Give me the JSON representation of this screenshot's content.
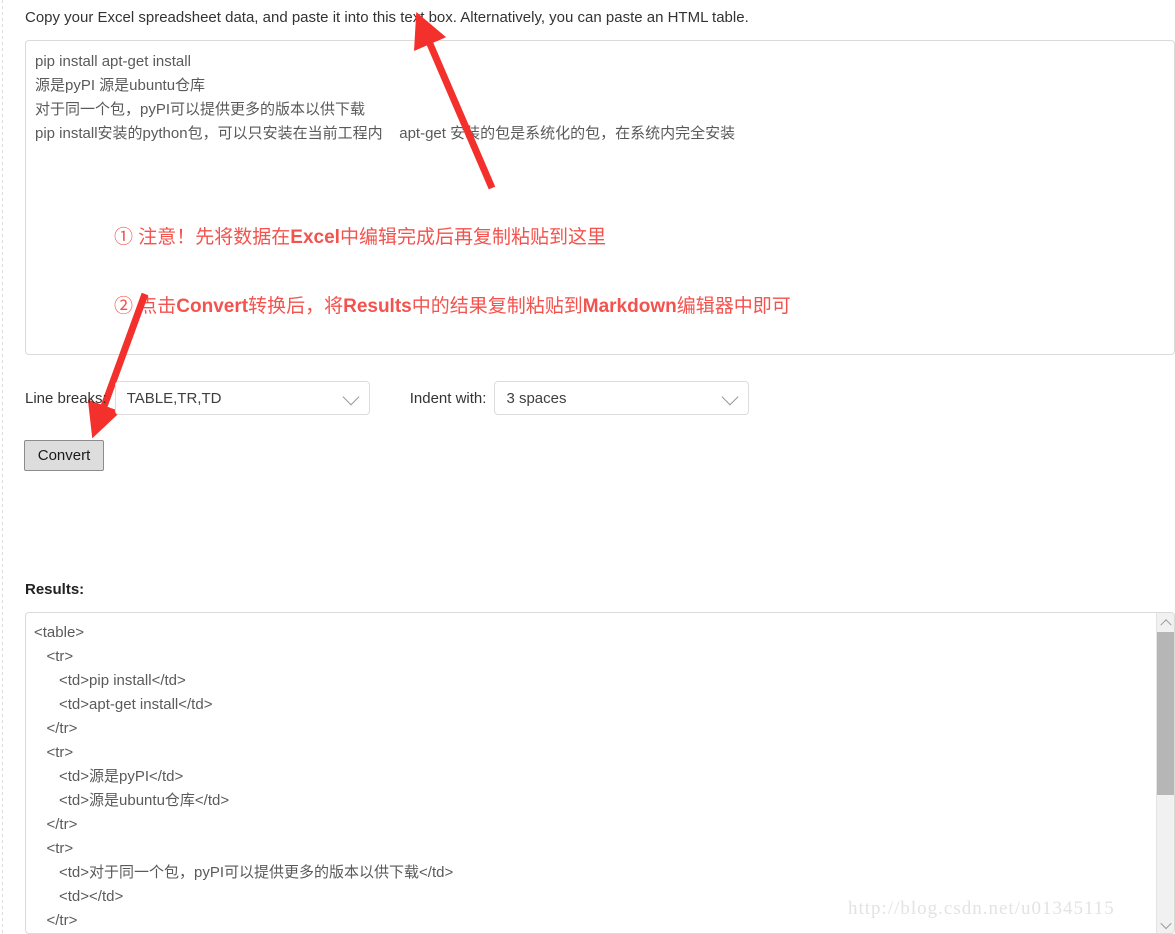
{
  "page": {
    "intro": "Copy your Excel spreadsheet data, and paste it into this text box. Alternatively, you can paste an HTML table.",
    "watermark": "http://blog.csdn.net/u01345115"
  },
  "input_area": {
    "name": "excel-paste-textarea",
    "placeholder": "",
    "lines": [
      "pip install apt-get install",
      "源是pyPI 源是ubuntu仓库",
      "对于同一个包，pyPI可以提供更多的版本以供下载",
      "pip install安装的python包，可以只安装在当前工程内    apt-get 安装的包是系统化的包，在系统内完全安装"
    ]
  },
  "annotations": {
    "color": "#f4524d",
    "items": [
      {
        "id": "annotation-one",
        "parts": [
          {
            "text": "① 注意！先将数据在",
            "emphasis": false
          },
          {
            "text": "Excel",
            "emphasis": true
          },
          {
            "text": "中编辑完成后再复制粘贴到这里",
            "emphasis": false
          }
        ]
      },
      {
        "id": "annotation-two",
        "parts": [
          {
            "text": "② 点击",
            "emphasis": false
          },
          {
            "text": "Convert",
            "emphasis": true
          },
          {
            "text": "转换后，将",
            "emphasis": false
          },
          {
            "text": "Results",
            "emphasis": true
          },
          {
            "text": "中的结果复制粘贴到",
            "emphasis": false
          },
          {
            "text": "Markdown",
            "emphasis": true
          },
          {
            "text": "编辑器中即可",
            "emphasis": false
          }
        ]
      }
    ]
  },
  "options": {
    "line_breaks": {
      "label": "Line breaks:",
      "selected": "TABLE,TR,TD",
      "icon": "chevron-down-icon"
    },
    "indent_with": {
      "label": "Indent with:",
      "selected": "3 spaces",
      "icon": "chevron-down-icon"
    }
  },
  "convert_button": {
    "label": "Convert"
  },
  "results": {
    "label": "Results:",
    "lines": [
      "<table>",
      "   <tr>",
      "      <td>pip install</td>",
      "      <td>apt-get install</td>",
      "   </tr>",
      "   <tr>",
      "      <td>源是pyPI</td>",
      "      <td>源是ubuntu仓库</td>",
      "   </tr>",
      "   <tr>",
      "      <td>对于同一个包，pyPI可以提供更多的版本以供下载</td>",
      "      <td></td>",
      "   </tr>"
    ],
    "scrollbar": {
      "up_icon": "chevron-up-icon",
      "down_icon": "chevron-down-icon"
    }
  }
}
